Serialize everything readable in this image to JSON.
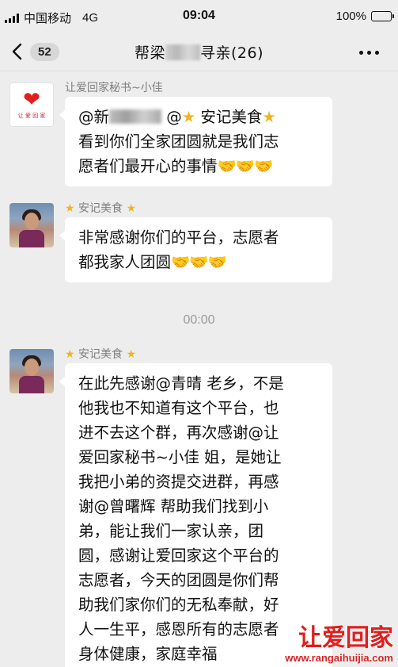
{
  "status_bar": {
    "carrier": "中国移动",
    "network": "4G",
    "time": "09:04",
    "battery": "100%",
    "battery_level": 1.0
  },
  "nav": {
    "unread_count": "52",
    "title_prefix": "帮梁",
    "title_suffix": "寻亲(26)"
  },
  "messages": [
    {
      "sender": "让爱回家秘书~小佳",
      "avatar_text": "让 爱 回 家",
      "line1_prefix": "@新",
      "line1_mid": " @",
      "line1_name": " 安记美食",
      "line2": "看到你们全家团圆就是我们志",
      "line3": "愿者们最开心的事情"
    },
    {
      "sender": "安记美食",
      "line1": "非常感谢你们的平台，志愿者",
      "line2": "都我家人团圆"
    },
    {
      "sender": "安记美食",
      "lines": [
        "在此先感谢@青晴 老乡，不是",
        "他我也不知道有这个平台，也",
        "进不去这个群，再次感谢@让",
        "爱回家秘书~小佳 姐，是她让",
        "我把小弟的资提交进群，再感",
        "谢@曾曙辉 帮助我们找到小",
        "弟，能让我们一家认亲，团",
        "圆，感谢让爱回家这个平台的",
        "志愿者，今天的团圆是你们帮",
        "助我们家你们的无私奉献，好",
        "人一生平，感恩所有的志愿者",
        "身体健康，家庭幸福"
      ]
    }
  ],
  "timestamp": "00:00",
  "watermark": {
    "logo": "让爱回家",
    "url": "www.rangaihuijia.com"
  },
  "icons": {
    "star": "★",
    "handshake": "🤝"
  }
}
